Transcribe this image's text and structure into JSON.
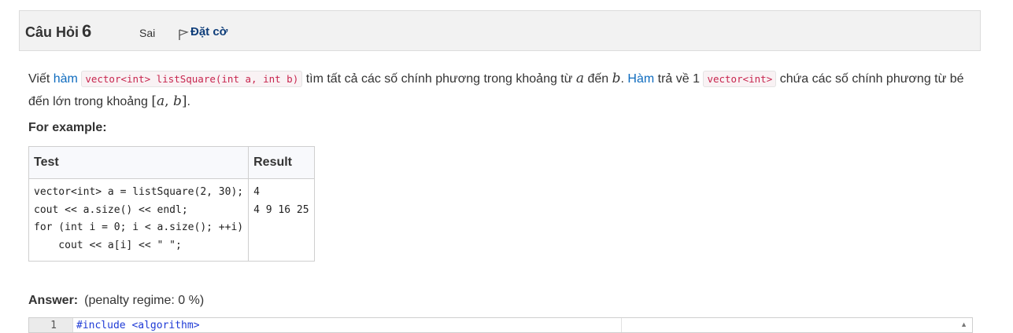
{
  "question": {
    "title_prefix": "Câu Hỏi",
    "number": "6",
    "state": "Sai",
    "flag_label": "Đặt cờ",
    "flag_icon": "flag-outline-icon"
  },
  "text": {
    "p1": "Viết ",
    "kw_ham1": "hàm",
    "code1": "vector<int> listSquare(int a, int b)",
    "p2": " tìm tất cả các số chính phương trong khoảng từ ",
    "var_a": "a",
    "p3": " đến ",
    "var_b": "b",
    "p4": ". ",
    "kw_ham2": "Hàm",
    "p5": " trả về 1 ",
    "code2": "vector<int>",
    "p6": " chứa các số chính phương từ bé đến lớn trong khoảng ",
    "interval_open": "[",
    "interval_a": "a",
    "interval_comma": ", ",
    "interval_b": "b",
    "interval_close": "]",
    "p7": "."
  },
  "example": {
    "heading": "For example:",
    "col_test": "Test",
    "col_result": "Result",
    "test_code": "vector<int> a = listSquare(2, 30);\ncout << a.size() << endl;\nfor (int i = 0; i < a.size(); ++i)\n    cout << a[i] << \" \";",
    "result": "4\n4 9 16 25"
  },
  "answer": {
    "label": "Answer:",
    "penalty": "(penalty regime: 0 %)",
    "line_number": "1",
    "first_line": "#include <algorithm>"
  },
  "colors": {
    "link": "#0f3e7a",
    "keyword_blue": "#0f6cbf",
    "code_red": "#c7254e",
    "header_bg": "#f2f2f2"
  }
}
